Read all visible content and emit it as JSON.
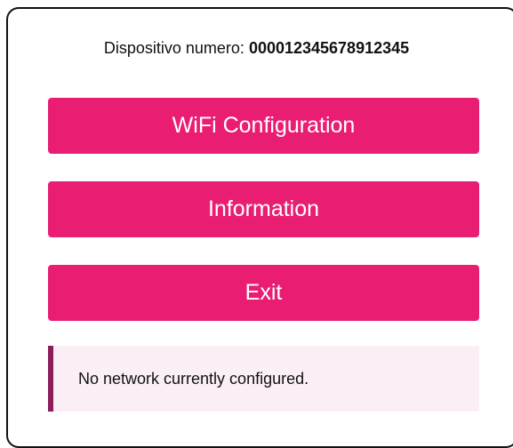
{
  "device": {
    "label": "Dispositivo numero: ",
    "number": "000012345678912345"
  },
  "menu": {
    "wifi_label": "WiFi Configuration",
    "info_label": "Information",
    "exit_label": "Exit"
  },
  "status": {
    "message": "No network currently configured."
  },
  "colors": {
    "button_bg": "#e91e73",
    "button_text": "#ffffff",
    "status_bg": "#fbeff6",
    "status_border": "#8a1d5a"
  }
}
